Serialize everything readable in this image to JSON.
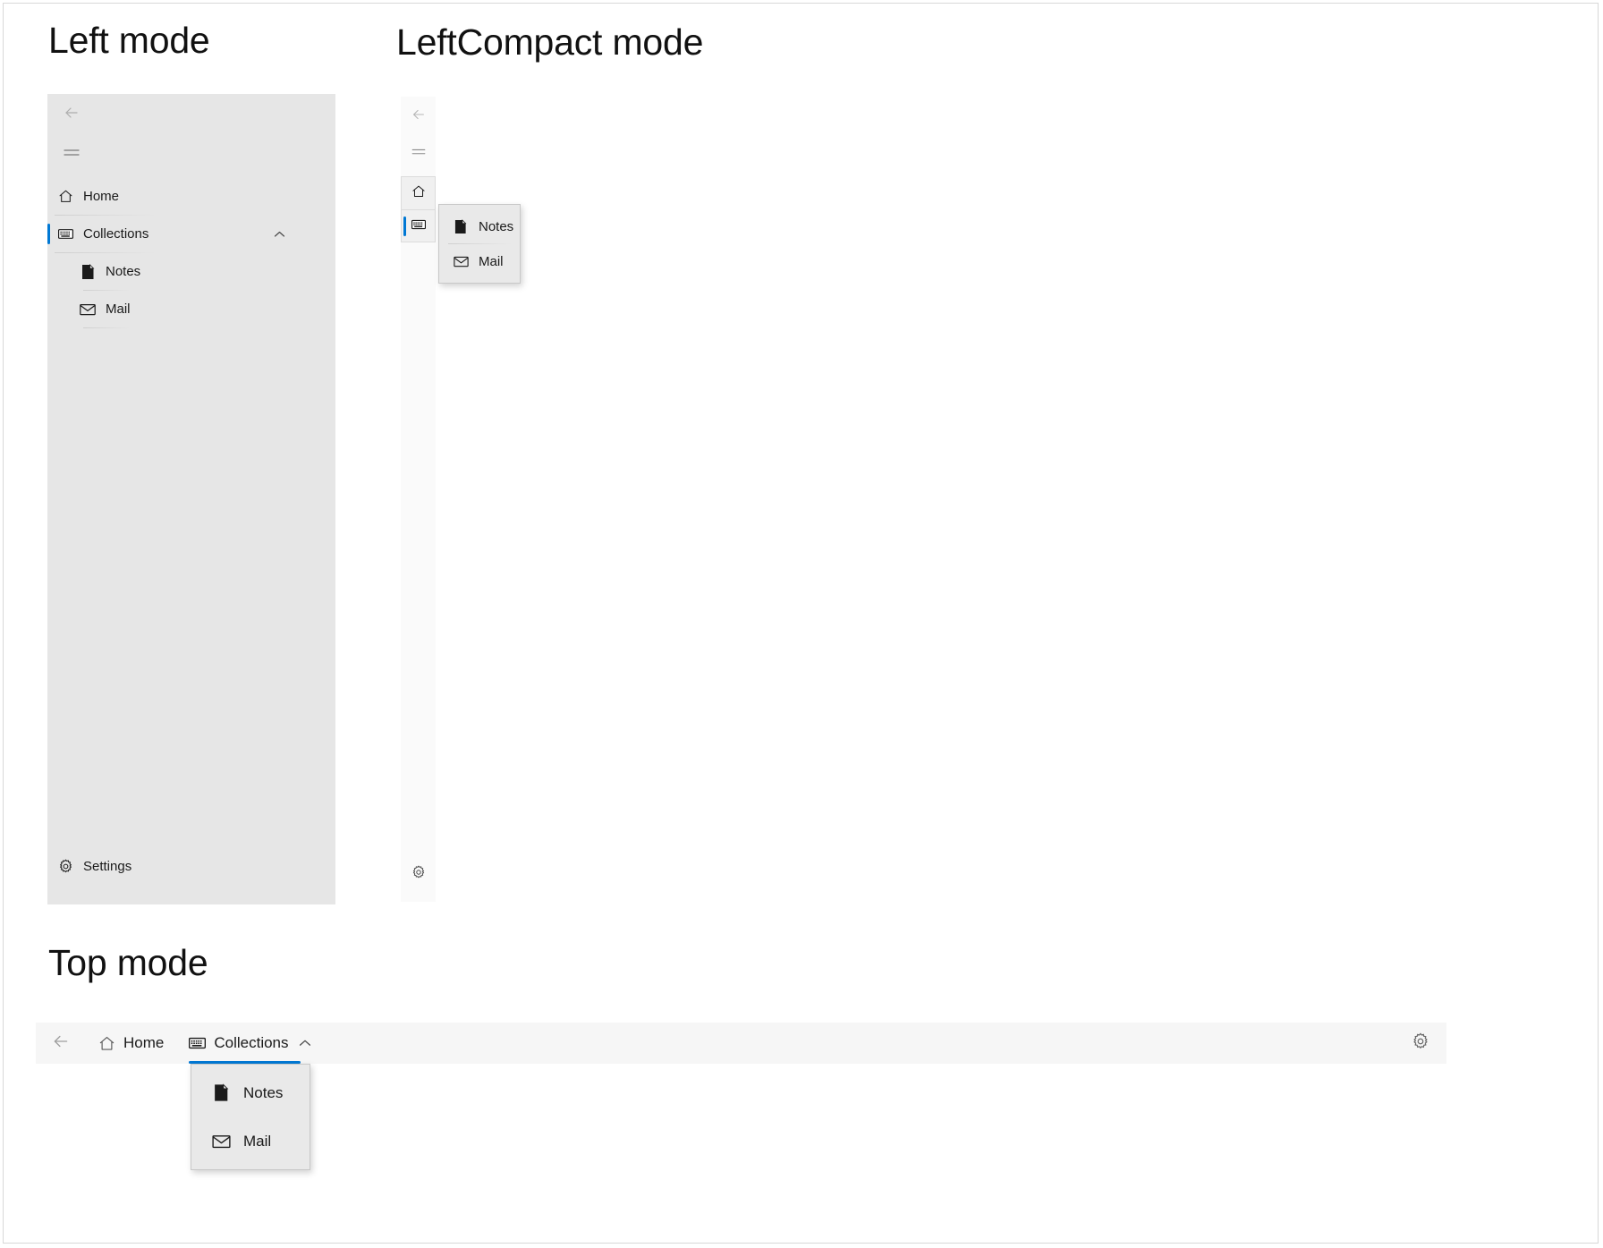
{
  "sections": {
    "left": {
      "title": "Left mode"
    },
    "left_compact": {
      "title": "LeftCompact mode"
    },
    "top": {
      "title": "Top mode"
    }
  },
  "colors": {
    "accent": "#0078d4",
    "left_pane_bg": "#e6e6e6",
    "compact_pane_bg": "#fafafa",
    "topbar_bg": "#f6f6f6",
    "flyout_bg": "#e9e9e9",
    "page_border": "#d8d8d8"
  },
  "left_pane": {
    "back_button": {
      "icon": "back-arrow-icon",
      "label": "Back",
      "enabled": false
    },
    "menu_button": {
      "icon": "hamburger-menu-icon",
      "label": "Menu"
    },
    "items": [
      {
        "icon": "home-icon",
        "label": "Home",
        "selected": false,
        "expandable": false
      },
      {
        "icon": "keyboard-collections-icon",
        "label": "Collections",
        "selected": true,
        "expandable": true,
        "expanded": true,
        "chevron": "chevron-up-icon"
      },
      {
        "icon": "document-notes-icon",
        "label": "Notes",
        "selected": false,
        "child": true
      },
      {
        "icon": "mail-envelope-icon",
        "label": "Mail",
        "selected": false,
        "child": true
      }
    ],
    "footer": {
      "icon": "settings-gear-icon",
      "label": "Settings"
    }
  },
  "left_compact": {
    "back_button": {
      "icon": "back-arrow-icon",
      "label": "Back",
      "enabled": false
    },
    "menu_button": {
      "icon": "hamburger-menu-icon",
      "label": "Menu"
    },
    "rail_items": [
      {
        "icon": "home-icon",
        "label": "Home",
        "selected": false
      },
      {
        "icon": "keyboard-collections-icon",
        "label": "Collections",
        "selected": true
      }
    ],
    "footer": {
      "icon": "settings-gear-icon",
      "label": "Settings"
    },
    "flyout": {
      "items": [
        {
          "icon": "document-notes-icon",
          "label": "Notes"
        },
        {
          "icon": "mail-envelope-icon",
          "label": "Mail"
        }
      ]
    }
  },
  "top": {
    "back_button": {
      "icon": "back-arrow-icon",
      "label": "Back",
      "enabled": false
    },
    "items": [
      {
        "icon": "home-icon",
        "label": "Home",
        "selected": false,
        "expandable": false
      },
      {
        "icon": "keyboard-collections-icon",
        "label": "Collections",
        "selected": true,
        "expandable": true,
        "expanded": true,
        "chevron": "chevron-up-icon"
      }
    ],
    "settings": {
      "icon": "settings-gear-icon",
      "label": "Settings"
    },
    "flyout": {
      "items": [
        {
          "icon": "document-notes-icon",
          "label": "Notes"
        },
        {
          "icon": "mail-envelope-icon",
          "label": "Mail"
        }
      ]
    }
  }
}
